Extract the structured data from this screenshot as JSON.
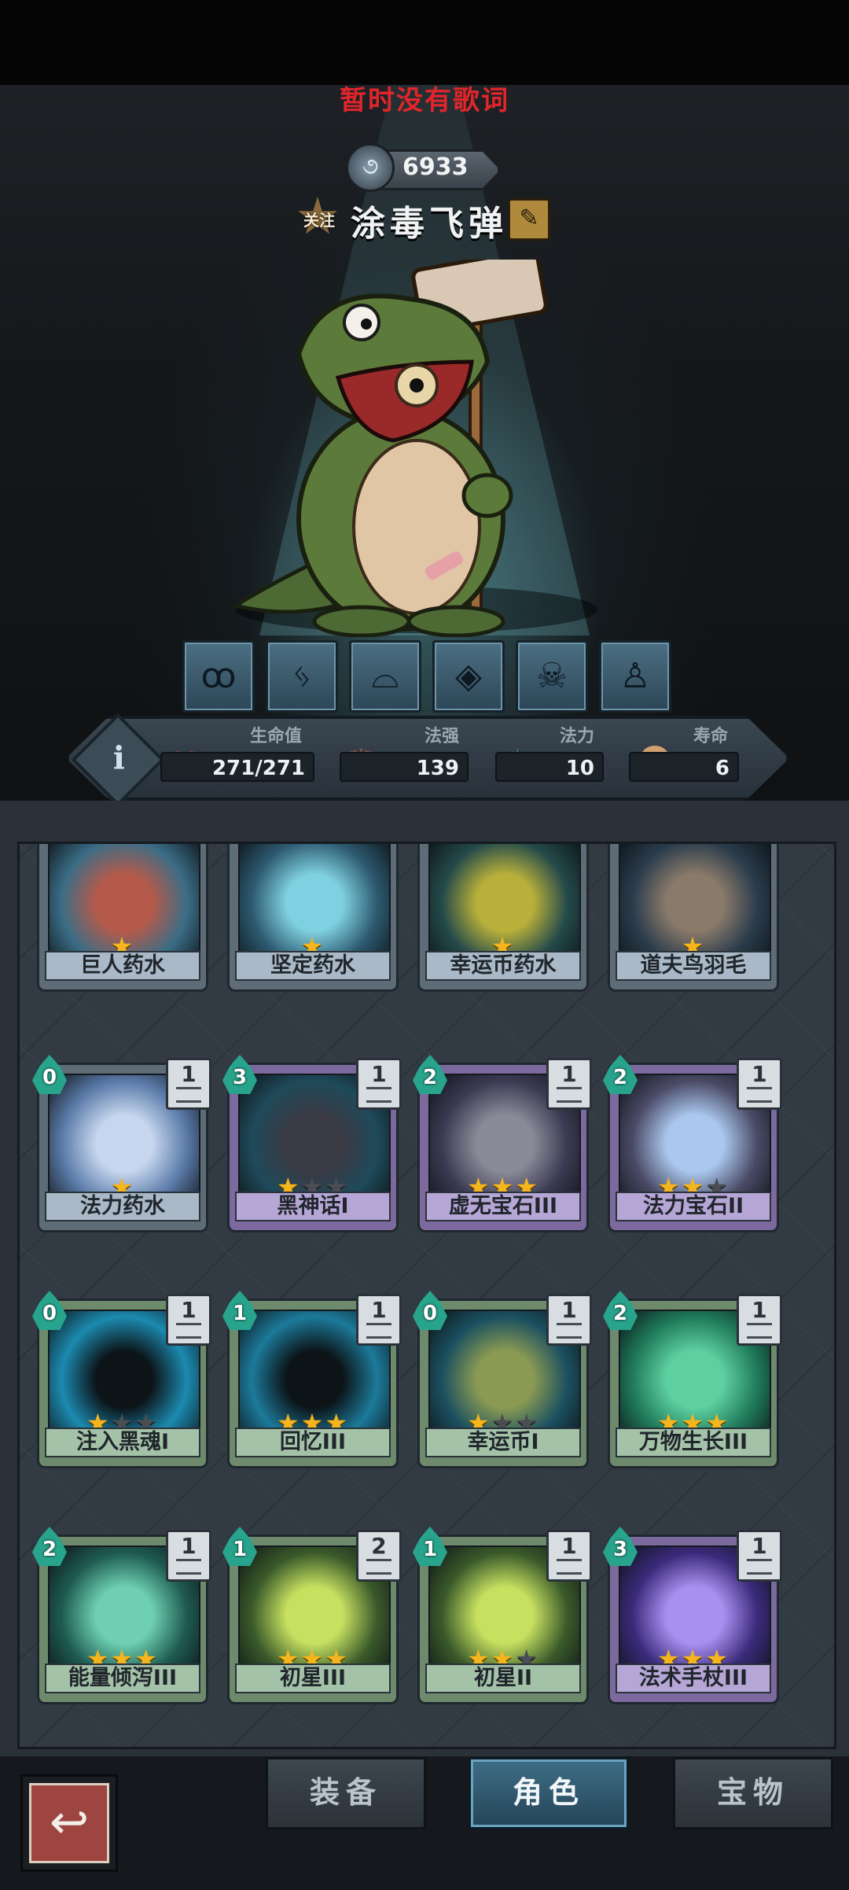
{
  "header": {
    "lyric": "暂时没有歌词",
    "souls": "6933",
    "follow_label": "关注",
    "hero_name": "涂毒飞弹"
  },
  "skill_icons": [
    "curse-swirl-icon",
    "rune-icon",
    "cowboy-hat-icon",
    "cards-icon",
    "skull-icon",
    "hero-figure-icon"
  ],
  "stats": {
    "hp_label": "生命值",
    "hp_value": "271/271",
    "spell_power_label": "法强",
    "spell_power_value": "139",
    "mana_label": "法力",
    "mana_value": "10",
    "lives_label": "寿命",
    "lives_value": "6"
  },
  "cards": [
    {
      "name": "巨人药水",
      "stars": 1,
      "max_stars": 1,
      "cost": null,
      "count": null,
      "color": "blue",
      "art": [
        "#3b6d86",
        "#b55a4a"
      ]
    },
    {
      "name": "坚定药水",
      "stars": 1,
      "max_stars": 1,
      "cost": null,
      "count": null,
      "color": "blue",
      "art": [
        "#2d5a70",
        "#7fd0e0"
      ]
    },
    {
      "name": "幸运币药水",
      "stars": 1,
      "max_stars": 1,
      "cost": null,
      "count": null,
      "color": "blue",
      "art": [
        "#244a4a",
        "#b8b03a"
      ]
    },
    {
      "name": "道夫鸟羽毛",
      "stars": 1,
      "max_stars": 1,
      "cost": null,
      "count": null,
      "color": "blue",
      "art": [
        "#2a3c4c",
        "#8a7a6a"
      ]
    },
    {
      "name": "法力药水",
      "stars": 1,
      "max_stars": 1,
      "cost": "0",
      "count": "1",
      "color": "blue",
      "art": [
        "#5a7aa8",
        "#c5d6ee"
      ]
    },
    {
      "name": "黑神话I",
      "stars": 1,
      "max_stars": 3,
      "cost": "3",
      "count": "1",
      "color": "purple",
      "art": [
        "#1f4a5a",
        "#3a3a44"
      ]
    },
    {
      "name": "虚无宝石III",
      "stars": 3,
      "max_stars": 3,
      "cost": "2",
      "count": "1",
      "color": "purple",
      "art": [
        "#3c3a52",
        "#8a8a98"
      ]
    },
    {
      "name": "法力宝石II",
      "stars": 2,
      "max_stars": 3,
      "cost": "2",
      "count": "1",
      "color": "purple",
      "art": [
        "#4a4a66",
        "#aac8ee"
      ]
    },
    {
      "name": "注入黑魂I",
      "stars": 1,
      "max_stars": 3,
      "cost": "0",
      "count": "1",
      "color": "green",
      "art": [
        "#1c8ab0",
        "#0c1418"
      ]
    },
    {
      "name": "回忆III",
      "stars": 3,
      "max_stars": 3,
      "cost": "1",
      "count": "1",
      "color": "green",
      "art": [
        "#1c7a9a",
        "#0c1418"
      ]
    },
    {
      "name": "幸运币I",
      "stars": 1,
      "max_stars": 3,
      "cost": "0",
      "count": "1",
      "color": "green",
      "art": [
        "#1b5060",
        "#8a9a52"
      ]
    },
    {
      "name": "万物生长III",
      "stars": 3,
      "max_stars": 3,
      "cost": "2",
      "count": "1",
      "color": "green",
      "art": [
        "#1f7a5a",
        "#5ed0a0"
      ]
    },
    {
      "name": "能量倾泻III",
      "stars": 3,
      "max_stars": 3,
      "cost": "2",
      "count": "1",
      "color": "green",
      "art": [
        "#1e5a50",
        "#6ed0b0"
      ]
    },
    {
      "name": "初星III",
      "stars": 3,
      "max_stars": 3,
      "cost": "1",
      "count": "2",
      "color": "green",
      "art": [
        "#3a5a2a",
        "#c6e060"
      ]
    },
    {
      "name": "初星II",
      "stars": 2,
      "max_stars": 3,
      "cost": "1",
      "count": "1",
      "color": "green",
      "art": [
        "#3a5a2a",
        "#c6e060"
      ]
    },
    {
      "name": "法术手杖III",
      "stars": 3,
      "max_stars": 3,
      "cost": "3",
      "count": "1",
      "color": "purple",
      "art": [
        "#3a2a7a",
        "#a890f0"
      ]
    }
  ],
  "nav": {
    "back_icon": "back-arrow-icon",
    "tab_equipment": "装备",
    "tab_character": "角色",
    "tab_treasure": "宝物"
  }
}
